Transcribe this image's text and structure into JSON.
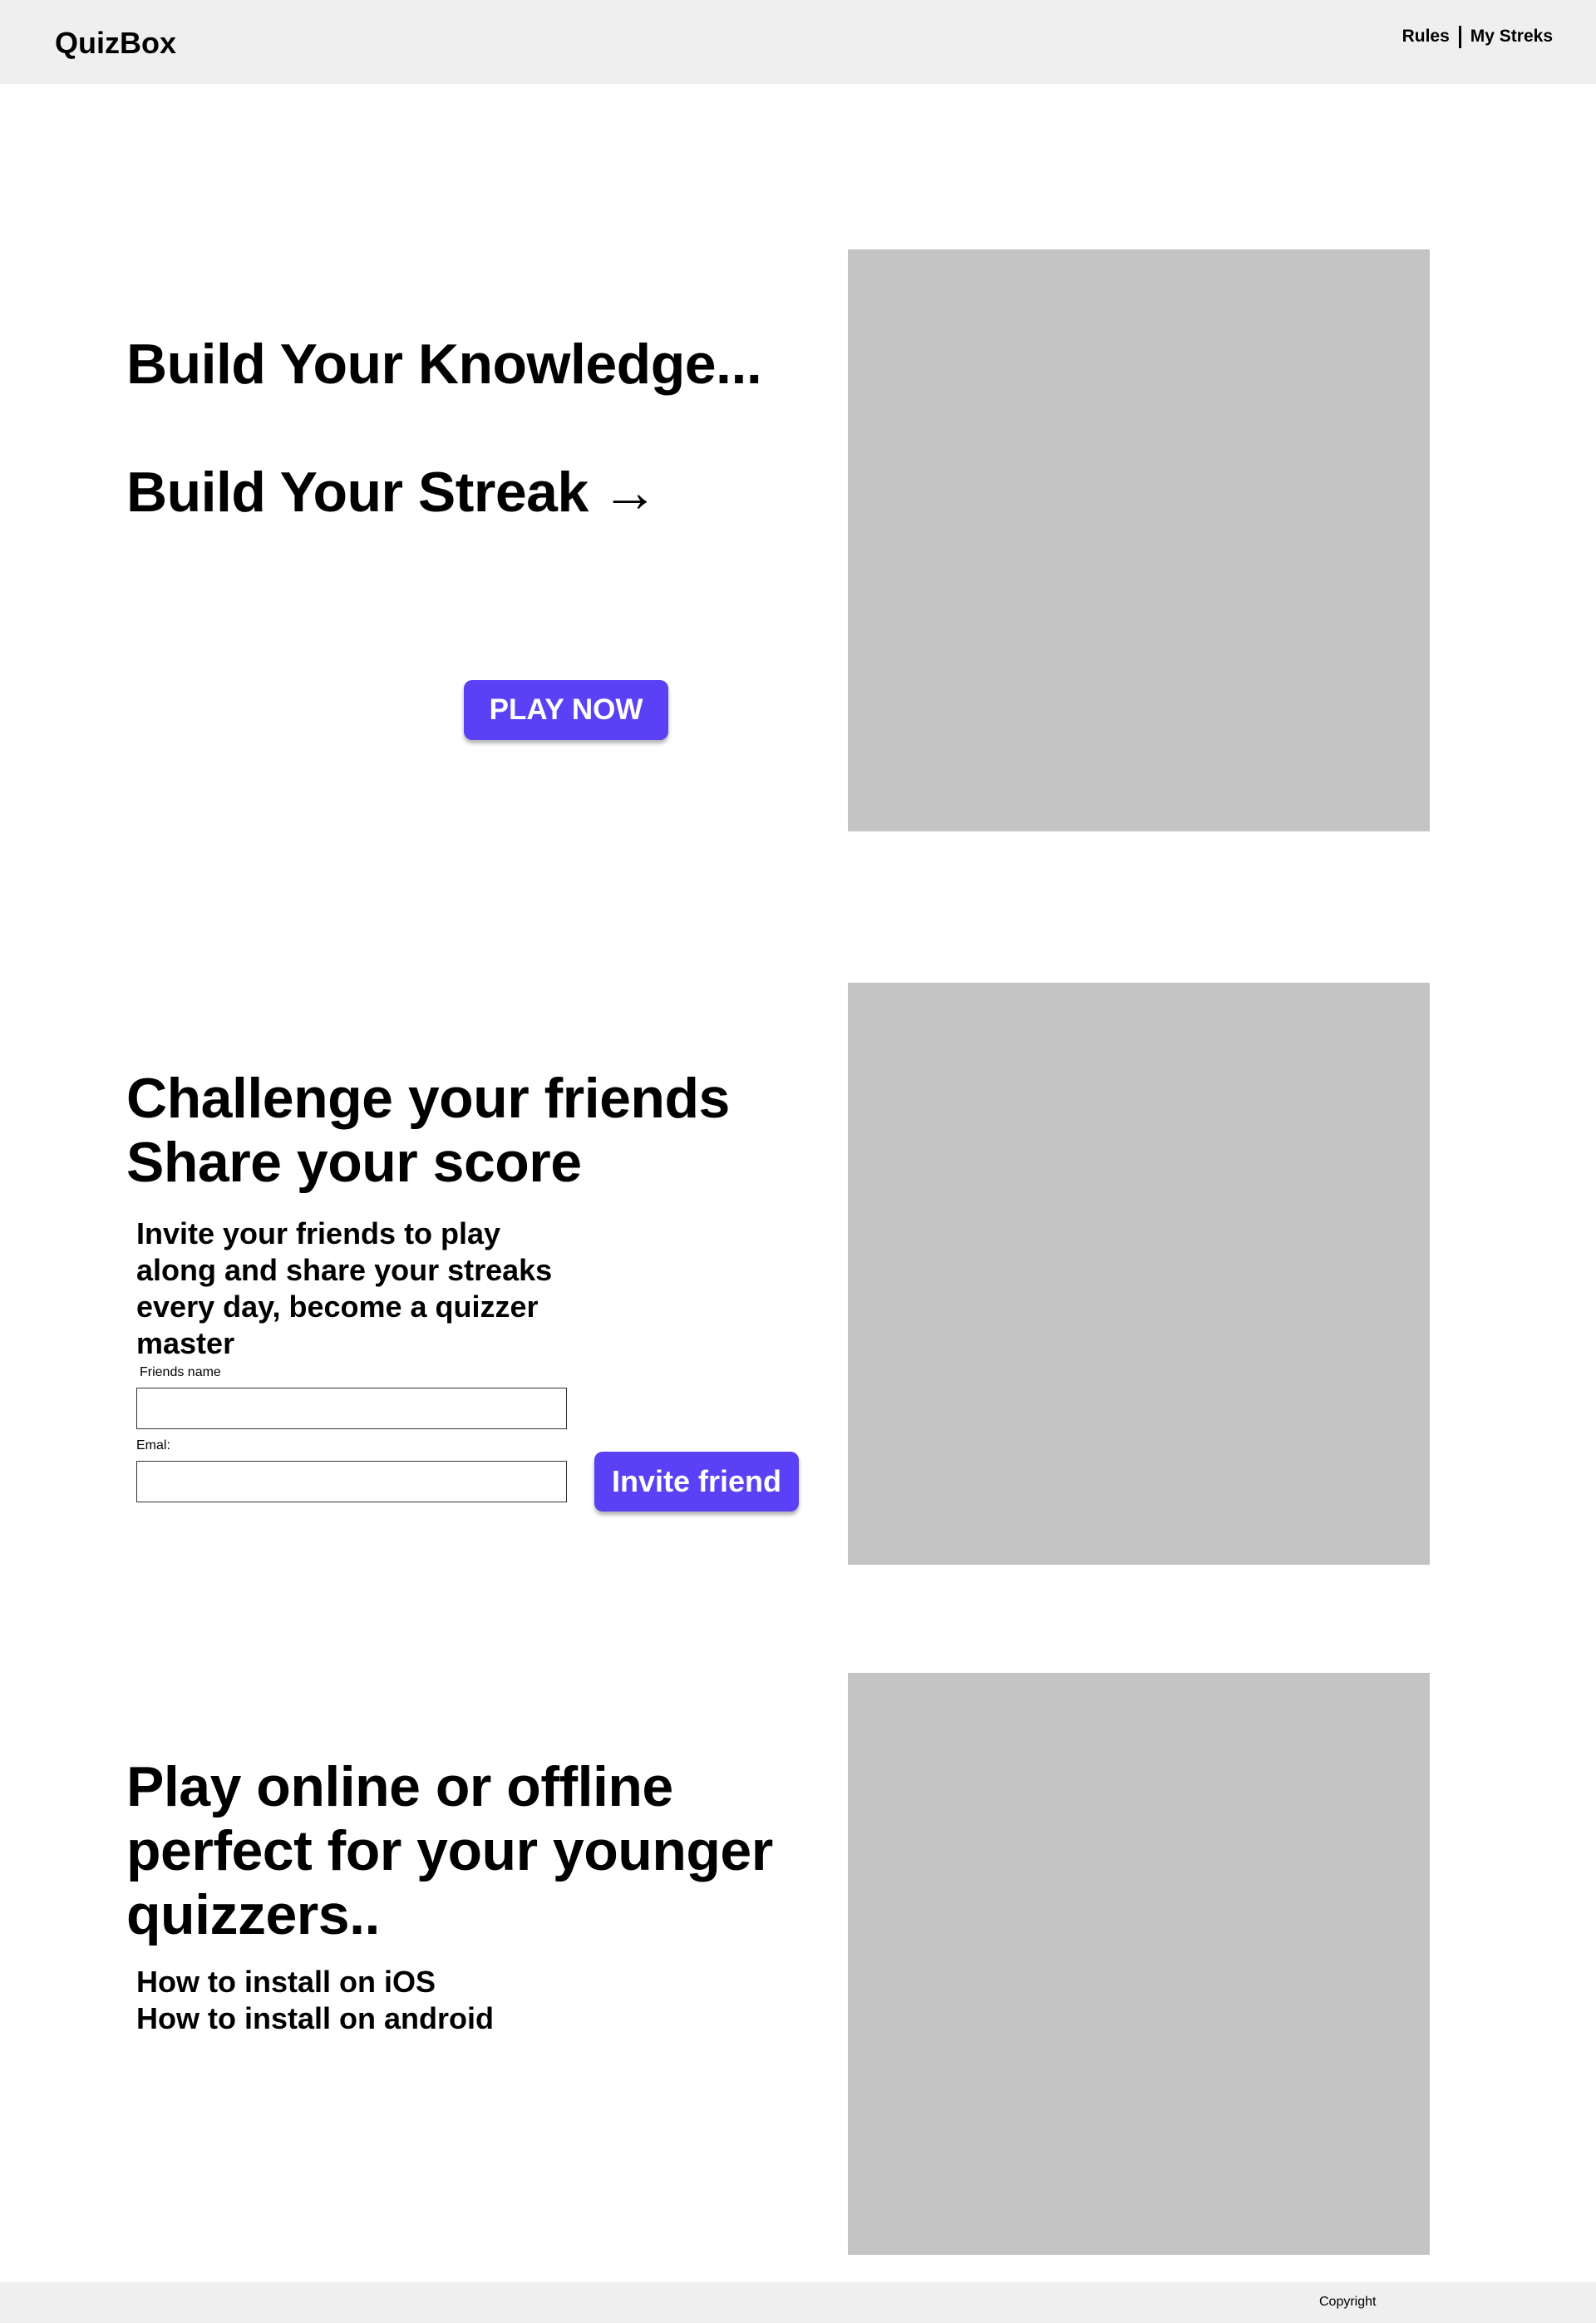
{
  "header": {
    "brand": "QuizBox",
    "nav": {
      "rules": "Rules",
      "streaks": "My Streks"
    }
  },
  "hero": {
    "line1": "Build Your Knowledge...",
    "line2": "Build Your Streak",
    "arrow": "→",
    "play_button": "PLAY NOW"
  },
  "challenge": {
    "title_line1": "Challenge your friends",
    "title_line2": "Share your score",
    "description_lines": [
      "Invite your friends to play",
      "along and share your streaks",
      "every day, become a quizzer",
      "master"
    ],
    "friend_name_label": "Friends name",
    "email_label": "Emal:",
    "friend_name_value": "",
    "email_value": "",
    "invite_button": "Invite friend"
  },
  "offline": {
    "title_lines": [
      "Play online or offline",
      "perfect for your younger",
      "quizzers.."
    ],
    "install_ios": "How to install on iOS",
    "install_android": "How to install on android"
  },
  "footer": {
    "copyright": "Copyright"
  },
  "colors": {
    "accent": "#5b41f5",
    "header_bg": "#efefef",
    "placeholder": "#c4c4c4"
  }
}
